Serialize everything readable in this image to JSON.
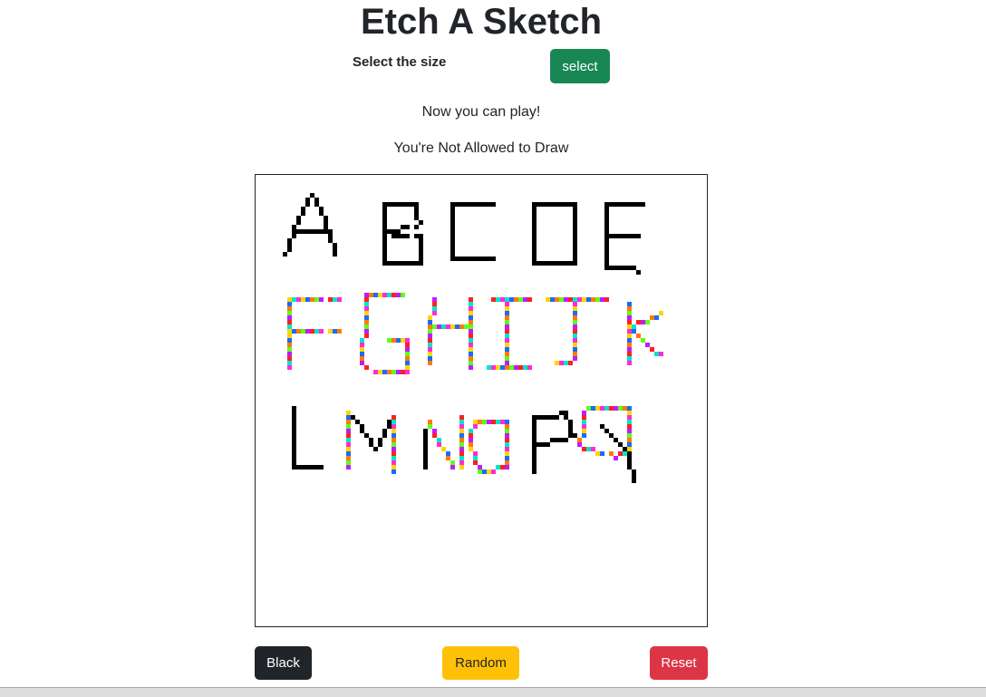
{
  "header": {
    "title": "Etch A Sketch"
  },
  "size_picker": {
    "label": "Select the size",
    "button_label": "select"
  },
  "status": {
    "play": "Now you can play!",
    "draw": "You're Not Allowed to Draw"
  },
  "controls": {
    "black_label": "Black",
    "random_label": "Random",
    "reset_label": "Reset"
  },
  "colors": {
    "select_button": "#198754",
    "black_button": "#212529",
    "random_button": "#ffc107",
    "reset_button": "#dc3545",
    "ink_black": "#000000",
    "rainbow": [
      "#ff2020",
      "#ffd500",
      "#5cff1a",
      "#00e5c8",
      "#1a6bff",
      "#c21aff",
      "#ff2bd6",
      "#ff7a00"
    ]
  },
  "board": {
    "drawn_letters": [
      {
        "letter": "A",
        "color_mode": "black"
      },
      {
        "letter": "B",
        "color_mode": "black"
      },
      {
        "letter": "C",
        "color_mode": "black"
      },
      {
        "letter": "D",
        "color_mode": "black"
      },
      {
        "letter": "E",
        "color_mode": "black"
      },
      {
        "letter": "F",
        "color_mode": "random"
      },
      {
        "letter": "G",
        "color_mode": "random"
      },
      {
        "letter": "H",
        "color_mode": "random"
      },
      {
        "letter": "I",
        "color_mode": "random"
      },
      {
        "letter": "J",
        "color_mode": "random"
      },
      {
        "letter": "K",
        "color_mode": "random"
      },
      {
        "letter": "L",
        "color_mode": "black"
      },
      {
        "letter": "M",
        "color_mode": "mixed"
      },
      {
        "letter": "N",
        "color_mode": "mixed"
      },
      {
        "letter": "O",
        "color_mode": "random"
      },
      {
        "letter": "P",
        "color_mode": "black"
      },
      {
        "letter": "Q",
        "color_mode": "mixed"
      }
    ]
  }
}
